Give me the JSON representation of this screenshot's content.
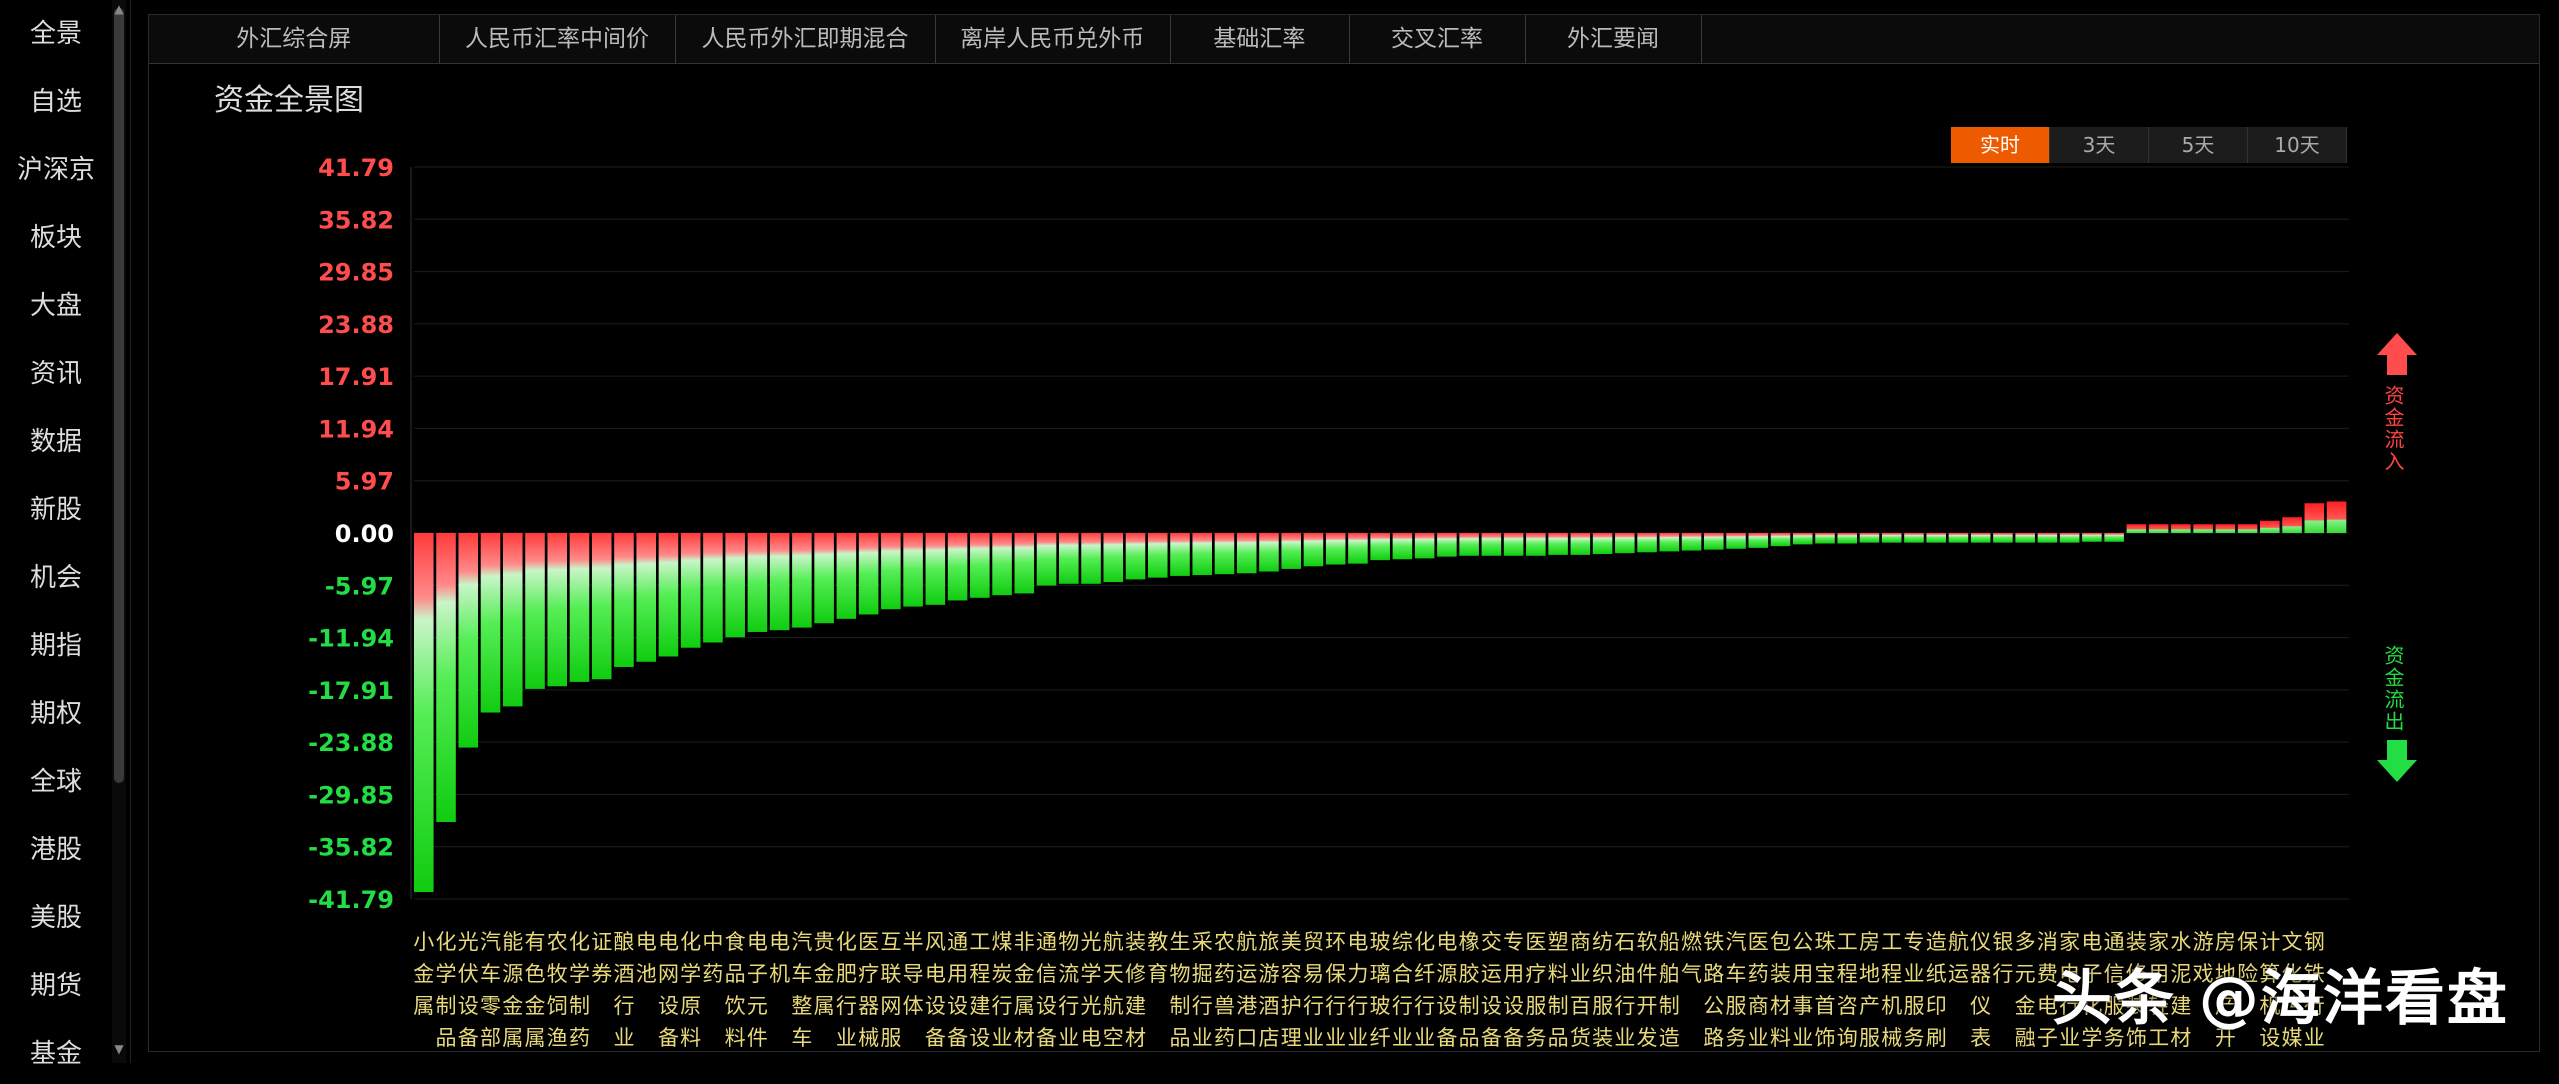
{
  "sidebar": {
    "items": [
      "全景",
      "自选",
      "沪深京",
      "板块",
      "大盘",
      "资讯",
      "数据",
      "新股",
      "机会",
      "期指",
      "期权",
      "全球",
      "港股",
      "美股",
      "期货",
      "基金"
    ]
  },
  "tabs": [
    "外汇综合屏",
    "人民币汇率中间价",
    "人民币外汇即期混合",
    "离岸人民币兑外币",
    "基础汇率",
    "交叉汇率",
    "外汇要闻"
  ],
  "chart_title": "资金全景图",
  "periods": [
    "实时",
    "3天",
    "5天",
    "10天"
  ],
  "active_period": "实时",
  "inflow_label": "资金流入",
  "outflow_label": "资金流出",
  "watermark": "头条 @海洋看盘",
  "colors": {
    "inflow": "#ff3333",
    "outflow": "#22dd22",
    "accent": "#ee5a00"
  },
  "chart_data": {
    "type": "bar",
    "ylim": [
      -41.79,
      41.79
    ],
    "yticks": [
      "41.79",
      "35.82",
      "29.85",
      "23.88",
      "17.91",
      "11.94",
      "5.97",
      "0.00",
      "-5.97",
      "-11.94",
      "-17.91",
      "-23.88",
      "-29.85",
      "-35.82",
      "-41.79"
    ],
    "categories": [
      "小金属",
      "化学制品",
      "光伏设备",
      "汽车零部件",
      "能源金属",
      "有色金属",
      "农牧饲渔",
      "化学制药",
      "证券",
      "酿酒行业",
      "电池",
      "电网设备",
      "化学原料",
      "中药",
      "食品饮料",
      "电子元件",
      "电机",
      "汽车整车",
      "贵金属",
      "化肥行业",
      "医疗器械",
      "互联网服务",
      "半导体",
      "风电设备",
      "通用设备",
      "工程建设",
      "煤炭行业",
      "非金属材料",
      "通信设备",
      "物流行业",
      "光学光电子",
      "航天航空",
      "装修建材",
      "教育",
      "生物制品",
      "采掘行业",
      "农药兽药",
      "航运港口",
      "旅游酒店",
      "美容护理",
      "贸易行业",
      "环保行业",
      "电力行业",
      "玻璃玻纤",
      "综合行业",
      "化纤行业",
      "电源设备",
      "橡胶制品",
      "交运设备",
      "专用设备",
      "医疗服务",
      "塑料制品",
      "商业百货",
      "纺织服装",
      "石油行业",
      "软件开发",
      "船舶制造",
      "燃气",
      "铁路公路",
      "汽车服务",
      "医药商业",
      "包装材料",
      "公用事业",
      "珠宝首饰",
      "工程咨询服务",
      "房地产服务",
      "工程机械",
      "专业服务",
      "造纸印刷",
      "航运",
      "仪器仪表",
      "银行",
      "多元金融",
      "消费电子",
      "家电行业",
      "电子化学品",
      "通信服务",
      "装修装饰",
      "家用轻工",
      "水泥建材",
      "游戏",
      "房地产开发",
      "保险",
      "计算机设备",
      "文化传媒",
      "钢铁行业"
    ],
    "values": [
      -41.0,
      -33.0,
      -24.5,
      -20.5,
      -19.8,
      -17.8,
      -17.5,
      -17.0,
      -16.7,
      -15.3,
      -14.7,
      -14.1,
      -13.1,
      -12.5,
      -11.9,
      -11.3,
      -11.1,
      -10.8,
      -10.3,
      -9.8,
      -9.3,
      -8.7,
      -8.4,
      -8.2,
      -7.7,
      -7.4,
      -7.1,
      -6.9,
      -6.0,
      -5.8,
      -5.8,
      -5.6,
      -5.3,
      -5.1,
      -4.9,
      -4.8,
      -4.7,
      -4.6,
      -4.4,
      -4.1,
      -3.8,
      -3.6,
      -3.5,
      -3.1,
      -3.0,
      -2.9,
      -2.7,
      -2.6,
      -2.6,
      -2.6,
      -2.6,
      -2.5,
      -2.5,
      -2.4,
      -2.3,
      -2.2,
      -2.1,
      -2.0,
      -1.9,
      -1.8,
      -1.7,
      -1.5,
      -1.3,
      -1.2,
      -1.2,
      -1.1,
      -1.1,
      -1.1,
      -1.1,
      -1.1,
      -1.1,
      -1.1,
      -1.1,
      -1.1,
      -1.1,
      -1.0,
      -1.0,
      1.0,
      1.0,
      1.0,
      1.0,
      1.0,
      1.0,
      1.4,
      1.8,
      3.4,
      3.6
    ]
  }
}
